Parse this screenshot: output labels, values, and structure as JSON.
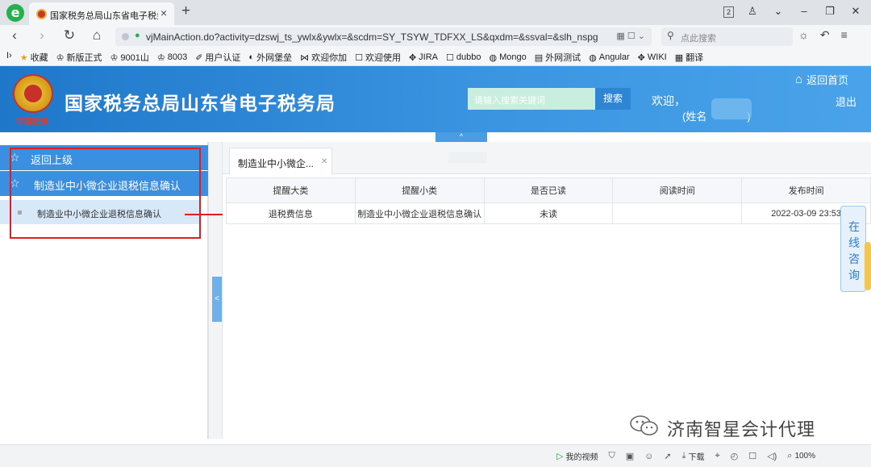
{
  "browser": {
    "tab_title": "国家税务总局山东省电子税务局",
    "tab_count": "2",
    "url": "vjMainAction.do?activity=dzswj_ts_ywlx&ywlx=&scdm=SY_TSYW_TDFXX_LS&qxdm=&ssval=&slh_nspg=",
    "search_placeholder": "点此搜索",
    "bookmarks": [
      "收藏",
      "新版正式",
      "9001山",
      "8003",
      "用户认证",
      "外网堡垒",
      "欢迎你加",
      "欢迎使用",
      "JIRA",
      "dubbo",
      "Mongo",
      "外网测试",
      "Angular",
      "WIKI",
      "翻译"
    ]
  },
  "header": {
    "emblem_text": "中国税务",
    "site_title": "国家税务总局山东省电子税务局",
    "search_placeholder": "请输入搜索关键词",
    "search_button": "搜索",
    "welcome": "欢迎，",
    "name_label": "(姓名",
    "name_close": ")",
    "home_link": "返回首页",
    "logout": "退出",
    "collapse_arrow": "^"
  },
  "sidebar": {
    "back_label": "返回上级",
    "menu_label": "制造业中小微企业退税信息确认",
    "sub_label": "制造业中小微企业退税信息确认",
    "toggle": "<"
  },
  "main": {
    "tab_label": "制造业中小微企...",
    "columns": [
      "提醒大类",
      "提醒小类",
      "是否已读",
      "阅读时间",
      "发布时间"
    ],
    "rows": [
      [
        "退税费信息",
        "制造业中小微企业退税信息确认",
        "未读",
        "",
        "2022-03-09 23:53"
      ]
    ]
  },
  "consult": {
    "label": "在线咨询"
  },
  "watermark": {
    "text": "济南智星会计代理"
  },
  "statusbar": {
    "items": [
      "我的视频",
      "下载",
      "100%"
    ]
  },
  "colors": {
    "banner": "#2a86d6",
    "sidebar_active": "#3b8fe0",
    "annotation": "#e31b23"
  }
}
